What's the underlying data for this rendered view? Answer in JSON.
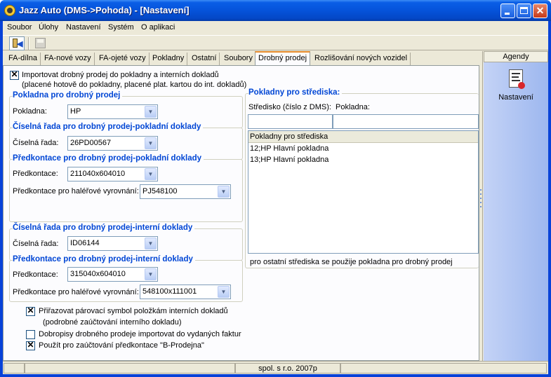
{
  "window": {
    "title": "Jazz Auto (DMS->Pohoda) - [Nastavení]"
  },
  "menu": [
    "Soubor",
    "Úlohy",
    "Nastavení",
    "Systém",
    "O aplikaci"
  ],
  "toolbar": {
    "buttons": [
      "exit-icon",
      "save-icon"
    ]
  },
  "tabs": [
    "FA-dílna",
    "FA-nové vozy",
    "FA-ojeté vozy",
    "Pokladny",
    "Ostatní",
    "Soubory",
    "Drobný prodej",
    "Rozlišování nových vozidel"
  ],
  "active_tab": "Drobný prodej",
  "left": {
    "import_checkbox": {
      "checked": true,
      "line1": "Importovat drobný prodej do pokladny a interních dokladů",
      "line2": "(placené hotově do pokladny, placené plat. kartou do int. dokladů)"
    },
    "group_pokladna": {
      "title": "Pokladna pro drobný prodej",
      "label": "Pokladna:",
      "value": "HP"
    },
    "group_rada_pokl": {
      "title": "Číselná řada pro drobný prodej-pokladní doklady",
      "label": "Číselná řada:",
      "value": "26PD00567"
    },
    "group_predk_pokl": {
      "title": "Předkontace pro drobný prodej-pokladní doklady",
      "label1": "Předkontace:",
      "value1": "211040x604010",
      "label2": "Předkontace pro haléřové vyrovnání:",
      "value2": "PJ548100"
    },
    "group_rada_int": {
      "title": "Číselná řada pro drobný prodej-interní doklady",
      "label": "Číselná řada:",
      "value": "ID06144"
    },
    "group_predk_int": {
      "title": "Předkontace pro drobný prodej-interní doklady",
      "label1": "Předkontace:",
      "value1": "315040x604010",
      "label2": "Předkontace pro haléřové vyrovnání:",
      "value2": "548100x111001"
    },
    "checkboxes": [
      {
        "checked": true,
        "line1": "Přiřazovat párovací symbol položkám interních dokladů",
        "line2": "(podrobné zaúčtování interního dokladu)"
      },
      {
        "checked": false,
        "line1": "Dobropisy drobného prodeje importovat do vydaných faktur",
        "line2": ""
      },
      {
        "checked": true,
        "line1": "Použít pro zaúčtování předkontace  \"B-Prodejna\"",
        "line2": ""
      }
    ]
  },
  "right": {
    "title": "Pokladny pro střediska:",
    "col_stredisko": "Středisko (číslo z DMS):",
    "col_pokladna": "Pokladna:",
    "input_stredisko": "",
    "input_pokladna": "",
    "list_header": "Pokladny pro střediska",
    "list_rows": [
      "12;HP Hlavní pokladna",
      "13;HP Hlavní pokladna"
    ],
    "note": "pro ostatní střediska se použije pokladna pro drobný prodej"
  },
  "sidebar": {
    "header": "Agendy",
    "item_label": "Nastavení"
  },
  "status": {
    "center": "spol. s r.o. 2007p"
  },
  "checked_mark": "✕",
  "dropdown_arrow": "▼",
  "colors": {
    "title_bar": "#0553da",
    "accent_group_title": "#0046d5",
    "active_tab_accent": "#e68b2c"
  }
}
